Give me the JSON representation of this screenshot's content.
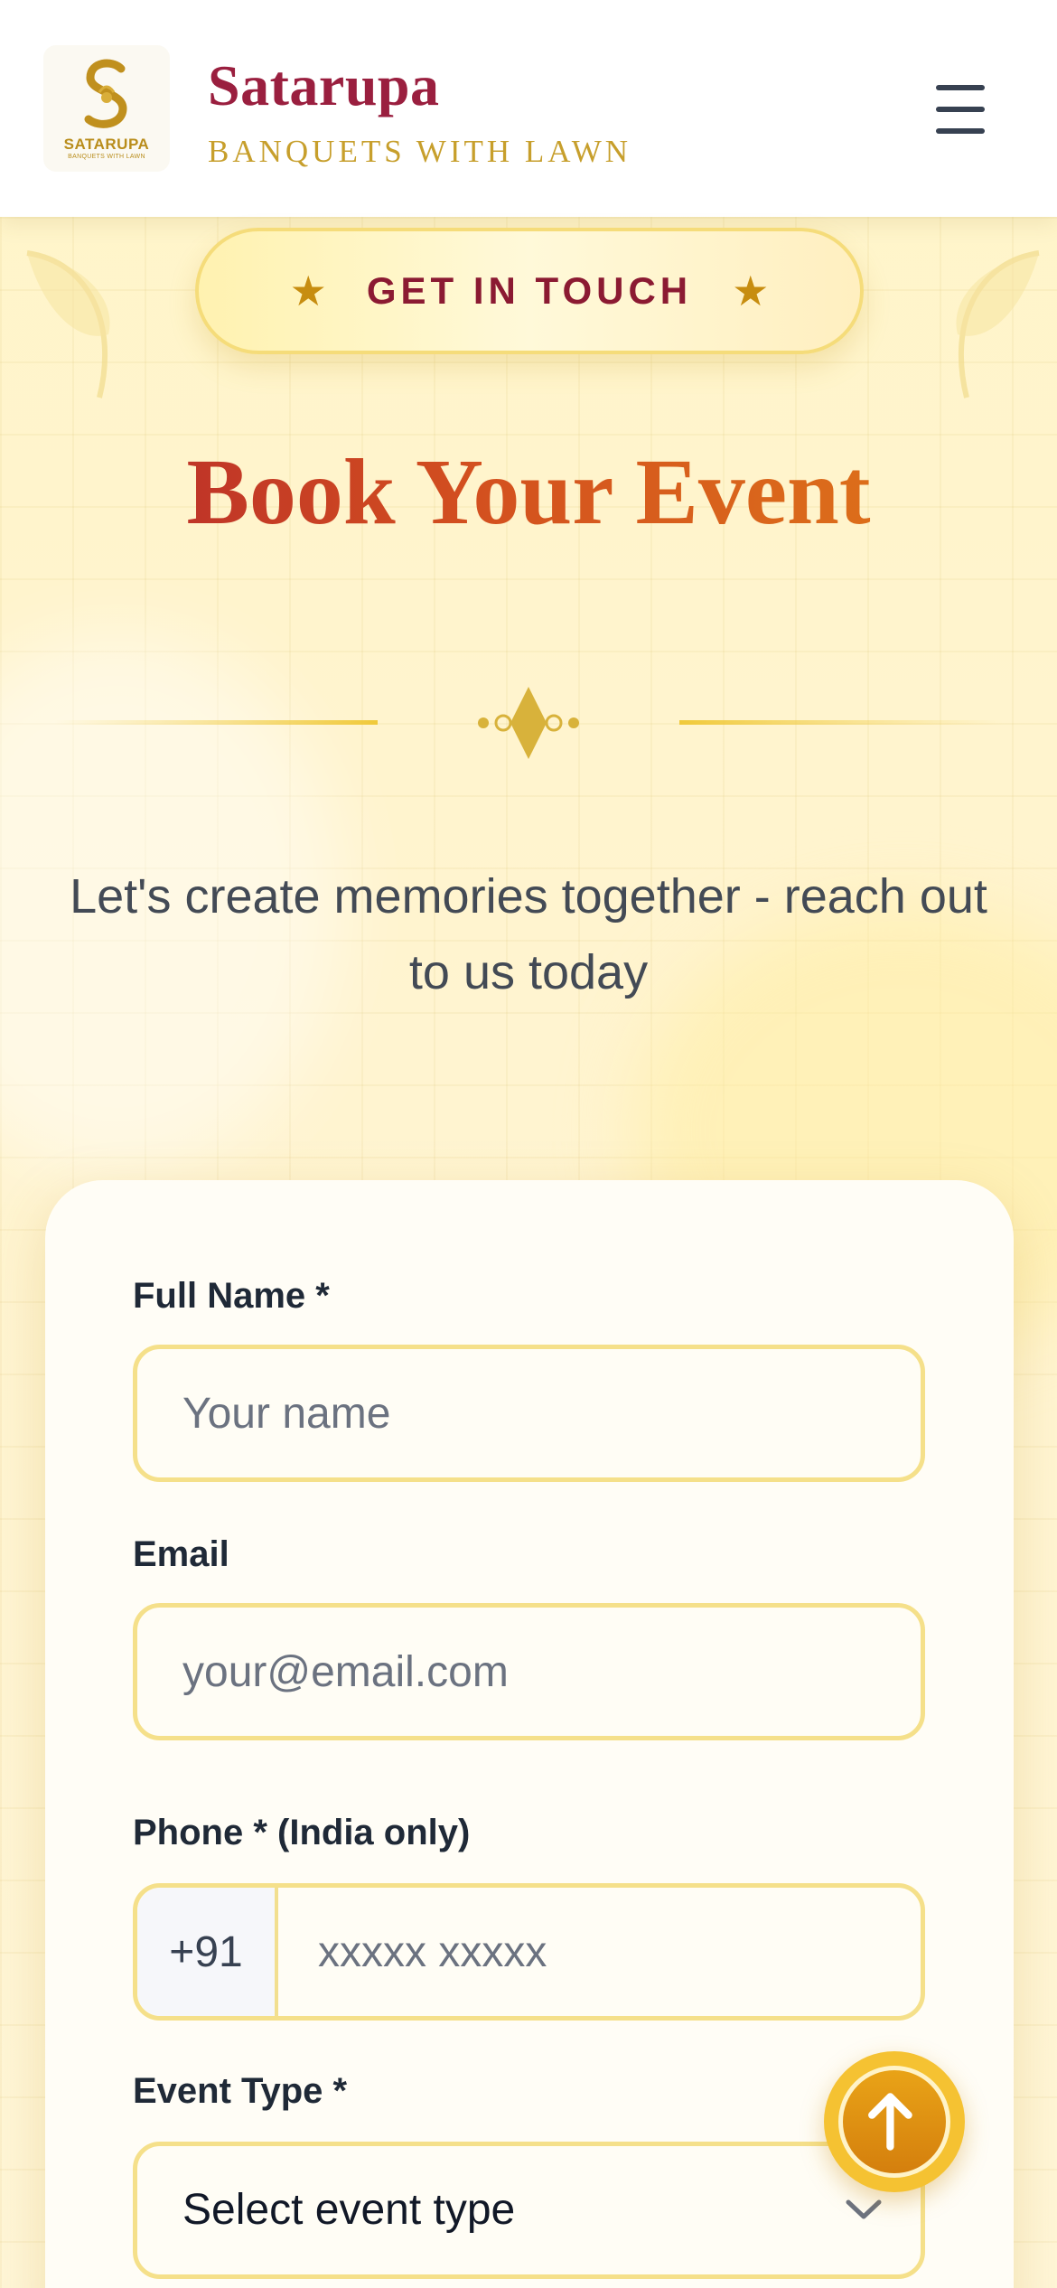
{
  "header": {
    "logo_text": "SATARUPA",
    "logo_subtext": "BANQUETS WITH LAWN",
    "brand_name": "Satarupa",
    "brand_tagline": "BANQUETS WITH LAWN",
    "menu_icon": "hamburger-menu-icon"
  },
  "hero": {
    "badge_label": "GET IN TOUCH",
    "badge_icon": "star-icon",
    "title": "Book Your Event",
    "subtitle": "Let's create memories together - reach out to us today"
  },
  "form": {
    "full_name": {
      "label": "Full Name *",
      "placeholder": "Your name",
      "value": ""
    },
    "email": {
      "label": "Email",
      "placeholder": "your@email.com",
      "value": ""
    },
    "phone": {
      "label": "Phone * (India only)",
      "prefix": "+91",
      "placeholder": "xxxxx xxxxx",
      "value": ""
    },
    "event_type": {
      "label": "Event Type *",
      "selected": "Select event type"
    }
  },
  "scroll_top_icon": "arrow-up-icon",
  "colors": {
    "brand_maroon": "#9a1f3f",
    "gold": "#c79f2c",
    "title_red": "#b3232d",
    "title_orange": "#e07b18",
    "field_border": "#f5e08a",
    "fab": "#e9a317"
  }
}
